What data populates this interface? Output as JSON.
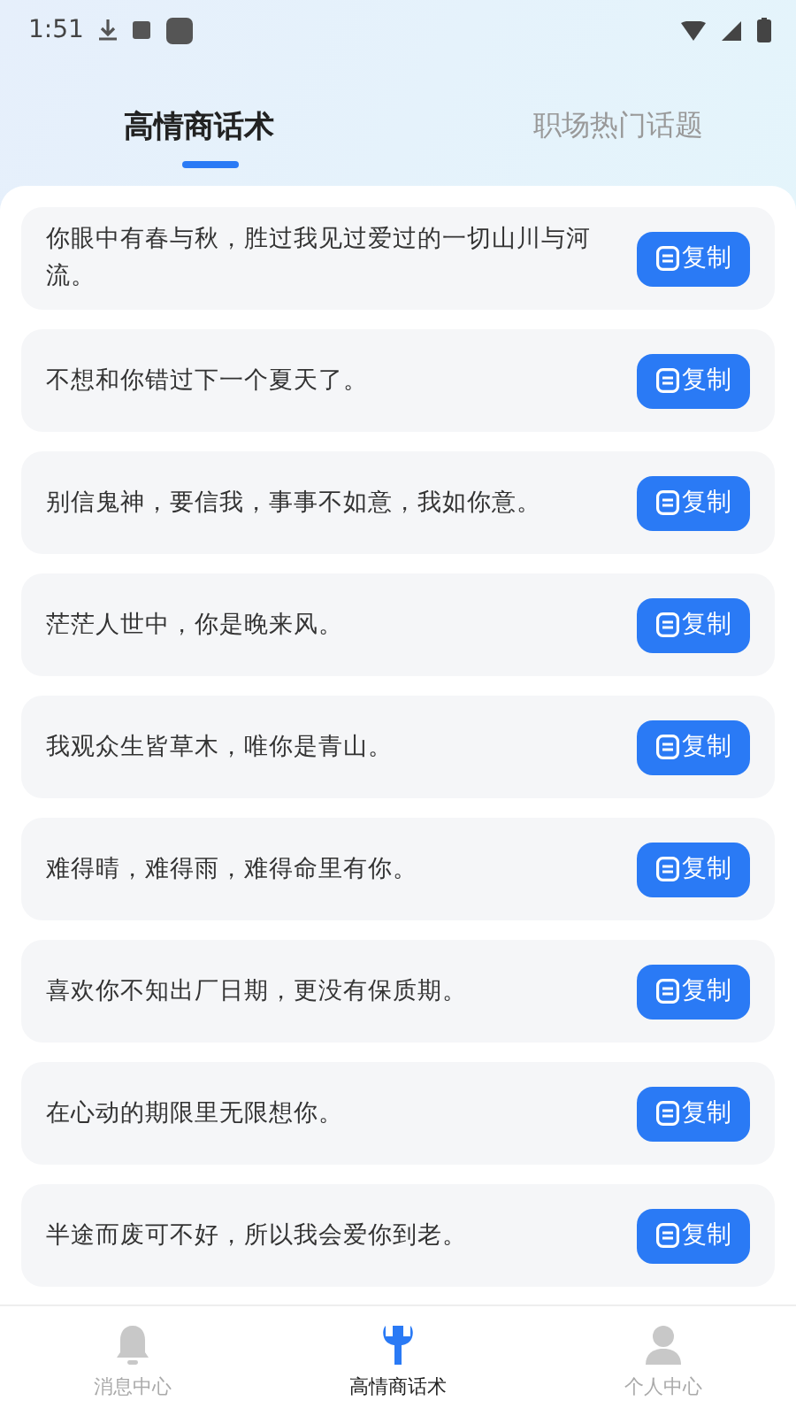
{
  "status_bar": {
    "time": "1:51"
  },
  "tabs": [
    {
      "label": "高情商话术",
      "selected": true
    },
    {
      "label": "职场热门话题",
      "selected": false
    }
  ],
  "phrases": [
    {
      "text": "你眼中有春与秋，胜过我见过爱过的一切山川与河流。",
      "button": "复制"
    },
    {
      "text": "不想和你错过下一个夏天了。",
      "button": "复制"
    },
    {
      "text": "别信鬼神，要信我，事事不如意，我如你意。",
      "button": "复制"
    },
    {
      "text": "茫茫人世中，你是晚来风。",
      "button": "复制"
    },
    {
      "text": "我观众生皆草木，唯你是青山。",
      "button": "复制"
    },
    {
      "text": "难得晴，难得雨，难得命里有你。",
      "button": "复制"
    },
    {
      "text": "喜欢你不知出厂日期，更没有保质期。",
      "button": "复制"
    },
    {
      "text": "在心动的期限里无限想你。",
      "button": "复制"
    },
    {
      "text": "半途而废可不好，所以我会爱你到老。",
      "button": "复制"
    }
  ],
  "bottom_nav": [
    {
      "label": "消息中心",
      "kind": "bell",
      "selected": false
    },
    {
      "label": "高情商话术",
      "kind": "wrench",
      "selected": true
    },
    {
      "label": "个人中心",
      "kind": "person",
      "selected": false
    }
  ]
}
